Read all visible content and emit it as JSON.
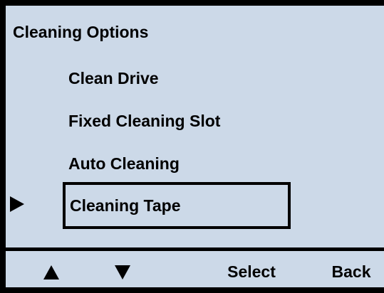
{
  "menu": {
    "title": "Cleaning Options",
    "items": [
      {
        "label": "Clean Drive"
      },
      {
        "label": "Fixed Cleaning Slot"
      },
      {
        "label": "Auto Cleaning"
      },
      {
        "label": "Cleaning Tape"
      }
    ],
    "selected_label": "Cleaning Tape"
  },
  "soft_keys": {
    "up_icon": "up-arrow-icon",
    "down_icon": "down-arrow-icon",
    "select_label": "Select",
    "back_label": "Back"
  },
  "colors": {
    "screen_background": "#ccd9e8",
    "foreground": "#000000"
  }
}
